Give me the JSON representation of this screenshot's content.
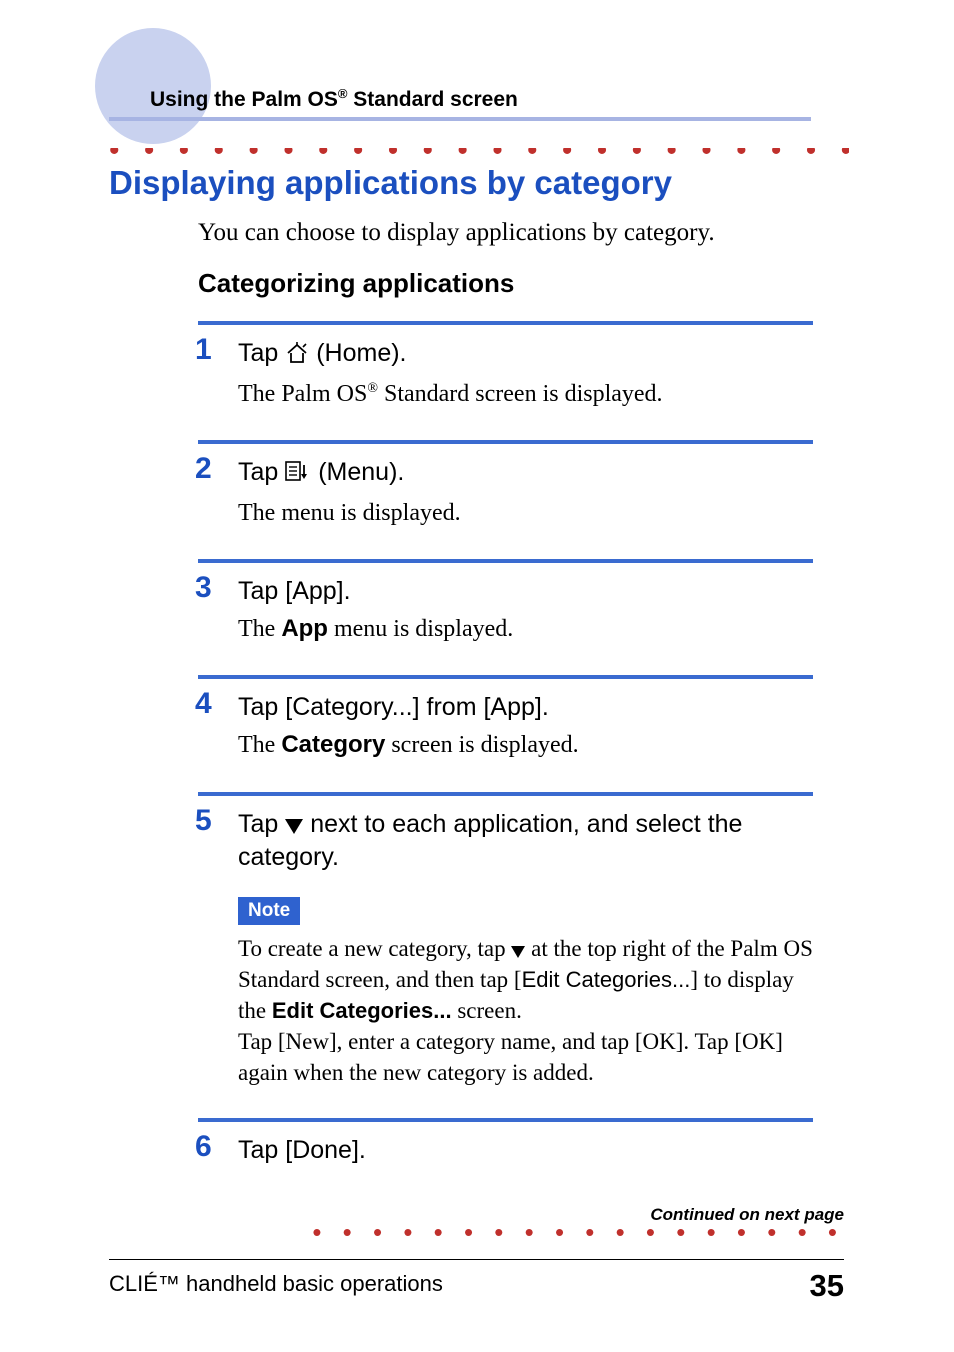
{
  "header": {
    "running_head_pre": "Using the Palm OS",
    "running_head_sup": "®",
    "running_head_post": " Standard screen"
  },
  "section": {
    "title": "Displaying applications by category",
    "intro": "You can choose to display applications by category.",
    "subhead": "Categorizing applications"
  },
  "steps": [
    {
      "num": "1",
      "action_pre": "Tap ",
      "icon": "home",
      "action_post": " (Home).",
      "result_pre": "The Palm OS",
      "result_sup": "®",
      "result_post": " Standard screen is displayed."
    },
    {
      "num": "2",
      "action_pre": "Tap ",
      "icon": "menu",
      "action_post": " (Menu).",
      "result": "The menu is displayed."
    },
    {
      "num": "3",
      "action": "Tap [App].",
      "result_pre": "The ",
      "result_bold": "App",
      "result_post": " menu is displayed."
    },
    {
      "num": "4",
      "action": "Tap [Category...] from [App].",
      "result_pre": "The ",
      "result_bold": "Category",
      "result_post": " screen is displayed."
    },
    {
      "num": "5",
      "action_pre": "Tap ",
      "action_triangle": true,
      "action_post": " next to each application, and select the category.",
      "note_label": "Note",
      "note": {
        "l1_pre": "To create a new category, tap ",
        "l1_post": " at the top right of the Palm OS Standard screen, and then tap [",
        "l1_ui": "Edit Categories...",
        "l1_end": "] to display the ",
        "l2_heavy": "Edit Categories...",
        "l2_post": " screen.",
        "l3": "Tap [New], enter a category name, and tap [OK]. Tap [OK] again when the new category is added."
      }
    },
    {
      "num": "6",
      "action": "Tap [Done]."
    }
  ],
  "continued": "Continued on next page",
  "footer": {
    "left": "CLIÉ™ handheld basic operations",
    "page": "35"
  }
}
